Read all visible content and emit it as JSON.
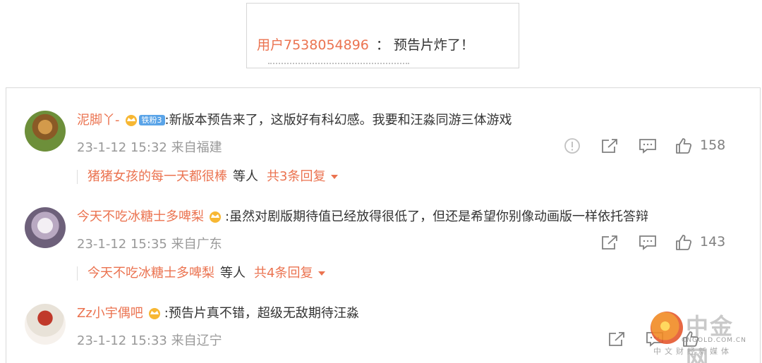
{
  "top_card": {
    "user": "用户7538054896",
    "separator": "：",
    "message": "预告片炸了！"
  },
  "comments": [
    {
      "user": "泥脚丫-",
      "fan_badge": "铁粉3",
      "text": ":新版本预告来了，这版好有科幻感。我要和汪淼同游三体游戏",
      "time_loc": "23-1-12 15:32 来自福建",
      "likes": "158",
      "reply_user": "猪猪女孩的每一天都很棒",
      "reply_etc": "等人",
      "reply_count": "共3条回复"
    },
    {
      "user": "今天不吃冰糖士多啤梨",
      "text": ":虽然对剧版期待值已经放得很低了，但还是希望你别像动画版一样依托答辩",
      "time_loc": "23-1-12 15:35 来自广东",
      "likes": "143",
      "reply_user": "今天不吃冰糖士多啤梨",
      "reply_etc": "等人",
      "reply_count": "共4条回复"
    },
    {
      "user": "Zz小宇偶吧",
      "text": ":预告片真不错，超级无敌期待汪淼",
      "time_loc": "23-1-12 15:33 来自辽宁"
    }
  ],
  "watermark": {
    "title": "中金网",
    "domain": "CNGOLD.COM.CN",
    "subtitle": "中文财经新媒体"
  },
  "colors": {
    "username": "#eb7350",
    "meta": "#999999",
    "text": "#333333",
    "badge": "#5aa4e8"
  },
  "icons": [
    "report-icon",
    "share-icon",
    "comment-icon",
    "like-icon",
    "crown-icon",
    "caret-down-icon"
  ]
}
